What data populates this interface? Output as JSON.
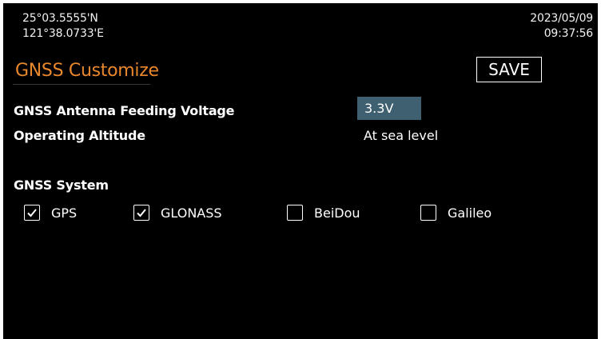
{
  "status": {
    "latitude": "25°03.5555'N",
    "longitude": "121°38.0733'E",
    "date": "2023/05/09",
    "time": "09:37:56"
  },
  "page": {
    "title": "GNSS Customize",
    "save_label": "SAVE"
  },
  "settings": {
    "antenna_voltage": {
      "label": "GNSS Antenna Feeding Voltage",
      "value": "3.3V"
    },
    "altitude": {
      "label": "Operating Altitude",
      "value": "At sea level"
    }
  },
  "gnss": {
    "section_label": "GNSS System",
    "systems": [
      {
        "label": "GPS",
        "checked": true
      },
      {
        "label": "GLONASS",
        "checked": true
      },
      {
        "label": "BeiDou",
        "checked": false
      },
      {
        "label": "Galileo",
        "checked": false
      }
    ]
  },
  "colors": {
    "title": "#e8872c",
    "selected_value_bg": "#3f6070",
    "background": "#000000"
  }
}
